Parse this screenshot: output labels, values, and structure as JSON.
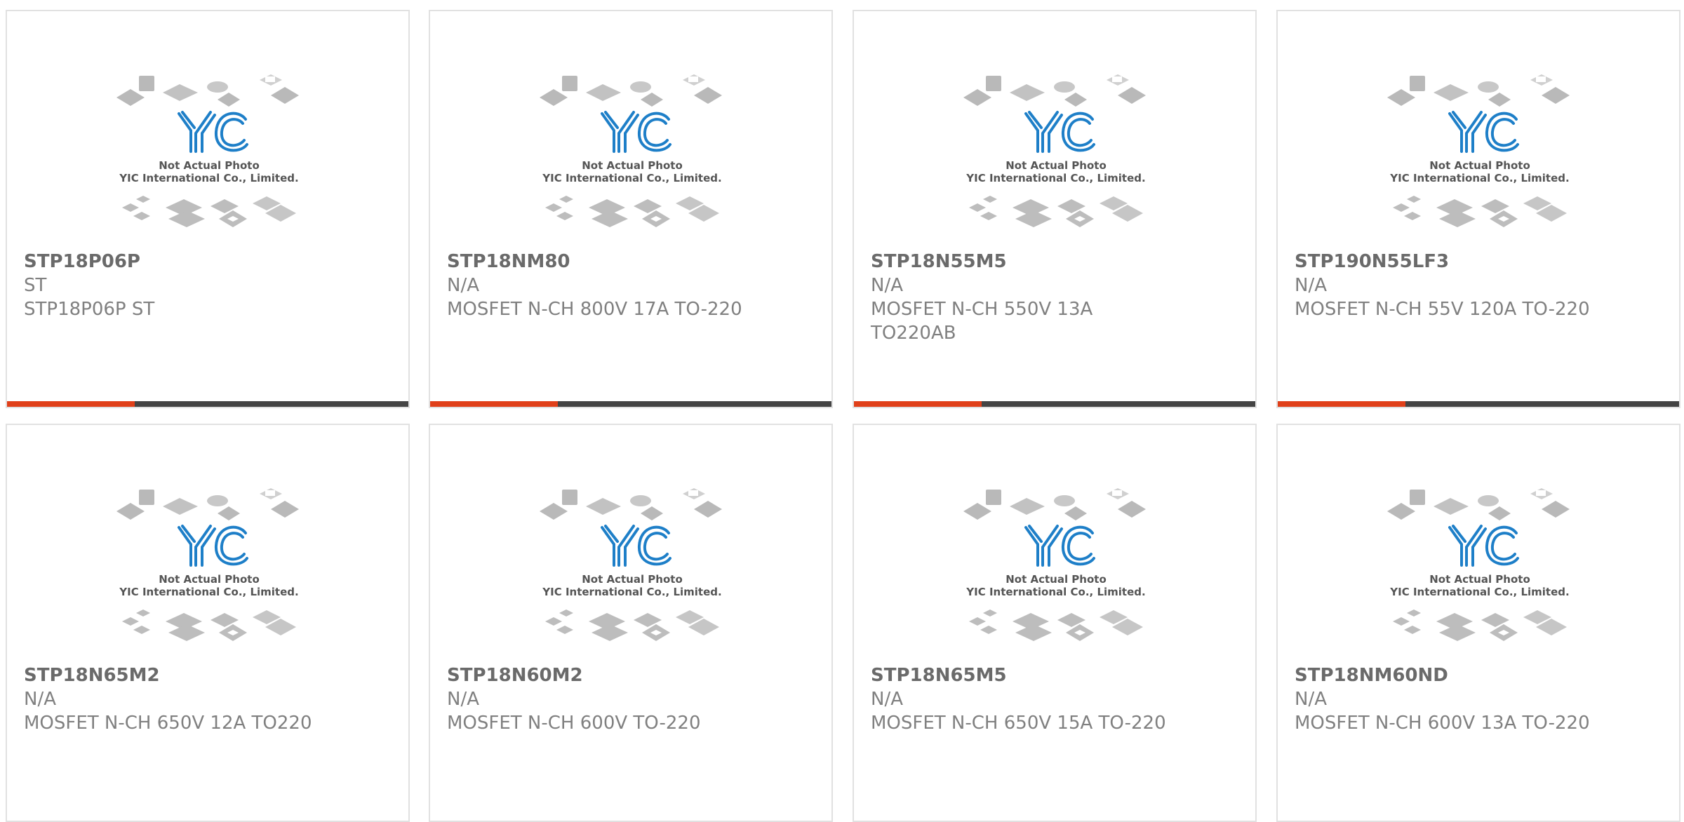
{
  "image_caption": {
    "line1": "Not Actual Photo",
    "line2": "YIC International Co., Limited.",
    "logo_text": "YIC"
  },
  "colors": {
    "accent": "#e0401a",
    "bar": "#444444",
    "logo_blue": "#1e7fc8",
    "chip_gray": "#b4b4b4",
    "title": "#6a6a6a",
    "text": "#808080"
  },
  "products": [
    {
      "part": "STP18P06P",
      "brand": "ST",
      "description": "STP18P06P ST"
    },
    {
      "part": "STP18NM80",
      "brand": "N/A",
      "description": "MOSFET N-CH 800V 17A TO-220"
    },
    {
      "part": "STP18N55M5",
      "brand": "N/A",
      "description": "MOSFET N-CH 550V 13A TO220AB"
    },
    {
      "part": "STP190N55LF3",
      "brand": "N/A",
      "description": "MOSFET N-CH 55V 120A TO-220"
    },
    {
      "part": "STP18N65M2",
      "brand": "N/A",
      "description": "MOSFET N-CH 650V 12A TO220"
    },
    {
      "part": "STP18N60M2",
      "brand": "N/A",
      "description": "MOSFET N-CH 600V TO-220"
    },
    {
      "part": "STP18N65M5",
      "brand": "N/A",
      "description": "MOSFET N-CH 650V 15A TO-220"
    },
    {
      "part": "STP18NM60ND",
      "brand": "N/A",
      "description": "MOSFET N-CH 600V 13A TO-220"
    }
  ]
}
